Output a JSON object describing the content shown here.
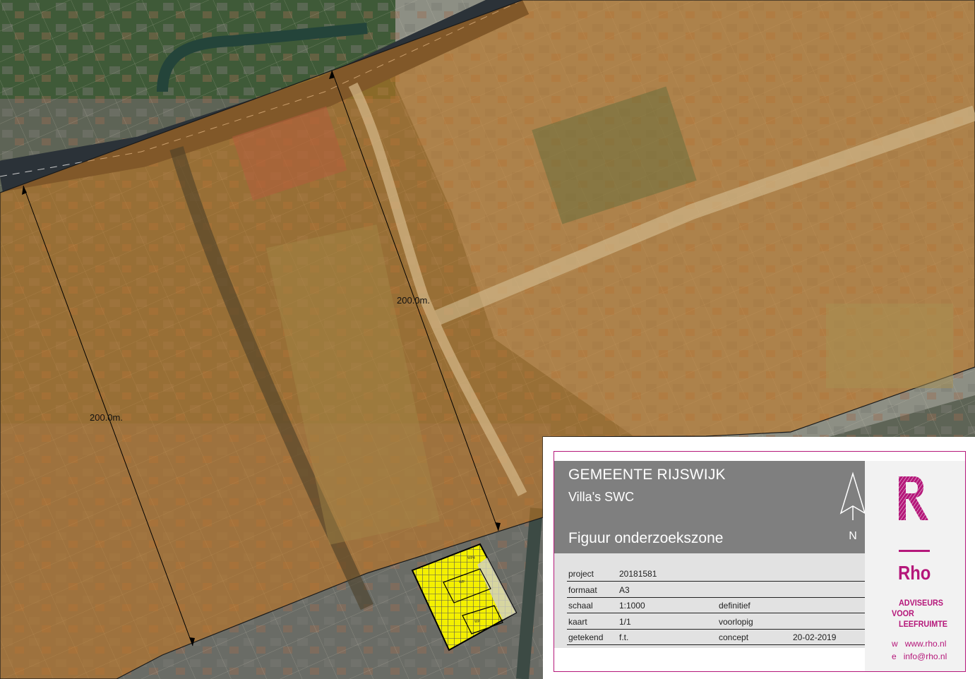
{
  "map": {
    "dimensions": [
      {
        "label": "200.0m."
      },
      {
        "label": "200.0m."
      }
    ],
    "plot_labels": [
      "WP4",
      "WP",
      "WP"
    ]
  },
  "title_block": {
    "organization": "GEMEENTE RIJSWIJK",
    "project_name": "Villa's SWC",
    "figure_title": "Figuur onderzoekszone",
    "north_label": "N",
    "rows": [
      {
        "label": "project",
        "value": "20181581",
        "status": "",
        "date": ""
      },
      {
        "label": "formaat",
        "value": "A3",
        "status": "",
        "date": ""
      },
      {
        "label": "schaal",
        "value": "1:1000",
        "status": "definitief",
        "date": ""
      },
      {
        "label": "kaart",
        "value": "1/1",
        "status": "voorlopig",
        "date": ""
      },
      {
        "label": "getekend",
        "value": "f.t.",
        "status": "concept",
        "date": "20-02-2019"
      }
    ]
  },
  "brand": {
    "letter": "R",
    "name": "Rho",
    "tagline": [
      "ADVISEURS",
      "VOOR",
      "LEEFRUIMTE"
    ],
    "web_prefix": "w",
    "website": "www.rho.nl",
    "email_prefix": "e",
    "email": "info@rho.nl",
    "color": "#b5177a"
  },
  "colors": {
    "zone_overlay": "#c8781e",
    "plot_fill": "#f4f000",
    "road": "#2b3238"
  }
}
